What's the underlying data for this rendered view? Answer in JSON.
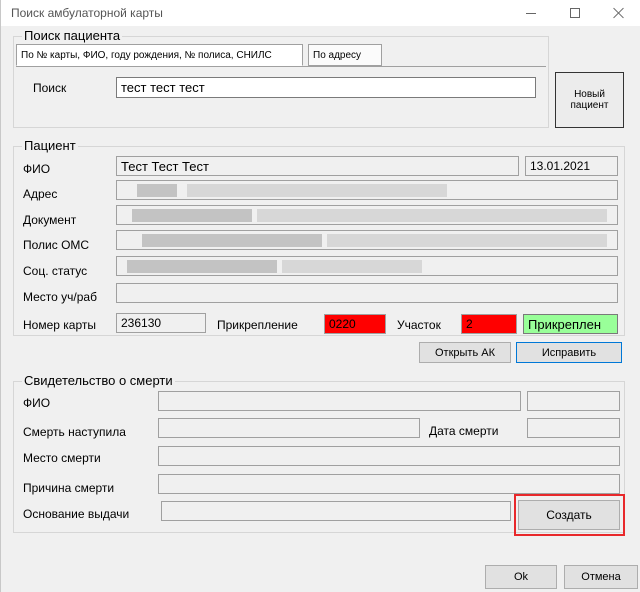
{
  "window": {
    "title": "Поиск амбулаторной карты"
  },
  "search": {
    "legend": "Поиск пациента",
    "tabs": [
      "По № карты, ФИО, году рождения, № полиса, СНИЛС",
      "По адресу"
    ],
    "label": "Поиск",
    "value": "тест тест тест",
    "new_patient": "Новый пациент"
  },
  "patient": {
    "legend": "Пациент",
    "fio_label": "ФИО",
    "fio_value": "Тест Тест Тест",
    "birth_date": "13.01.2021",
    "address_label": "Адрес",
    "document_label": "Документ",
    "policy_label": "Полис ОМС",
    "social_label": "Соц. статус",
    "work_label": "Место уч/раб",
    "card_label": "Номер карты",
    "card_value": "236130",
    "attach_label": "Прикрепление",
    "attach_value": "0220",
    "area_label": "Участок",
    "area_value": "2",
    "attach_status": "Прикреплен",
    "open_ak": "Открыть АК",
    "fix": "Исправить"
  },
  "death": {
    "legend": "Свидетельство о смерти",
    "fio_label": "ФИО",
    "occurred_label": "Смерть наступила",
    "date_label": "Дата смерти",
    "place_label": "Место смерти",
    "cause_label": "Причина смерти",
    "basis_label": "Основание выдачи",
    "create": "Создать"
  },
  "footer": {
    "ok": "Ok",
    "cancel": "Отмена"
  },
  "colors": {
    "alert_red": "#ff0000",
    "attached_green": "#99ff99",
    "highlight": "#e8282b",
    "focus_blue": "#0078d7"
  }
}
